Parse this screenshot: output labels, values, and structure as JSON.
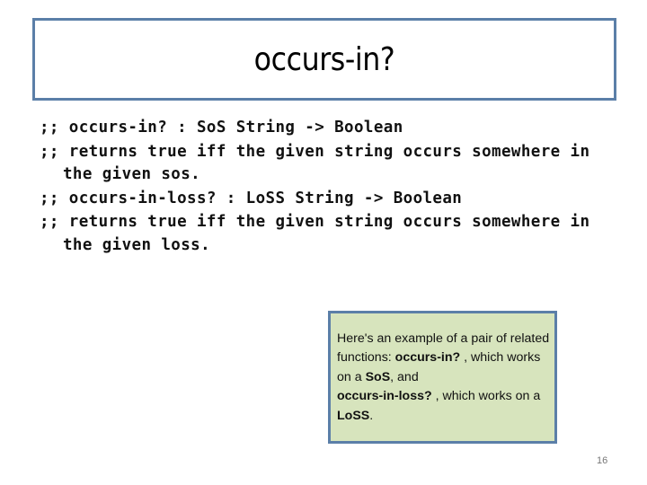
{
  "slide": {
    "title": "occurs-in?",
    "code_lines": [
      {
        "text": ";; occurs-in? : SoS String -> Boolean",
        "continuation": false
      },
      {
        "text": ";; returns true iff the given string occurs somewhere in",
        "continuation": false
      },
      {
        "text": "the given sos.",
        "continuation": true
      },
      {
        "text": ";; occurs-in-loss? : LoSS String -> Boolean",
        "continuation": false
      },
      {
        "text": ";; returns true iff the given string occurs somewhere in",
        "continuation": false
      },
      {
        "text": "the given loss.",
        "continuation": true
      }
    ],
    "note": {
      "part1": "Here's an example of a pair of related functions: ",
      "bold1": "occurs-in?",
      "part2": " , which works on a ",
      "bold2": "SoS",
      "part3": ", and ",
      "bold3": "occurs-in-loss?",
      "part4": " , which works on a ",
      "bold4": "LoSS",
      "part5": "."
    },
    "page_number": "16",
    "colors": {
      "border": "#5b7fa8",
      "note_fill": "#d7e4bd"
    }
  }
}
